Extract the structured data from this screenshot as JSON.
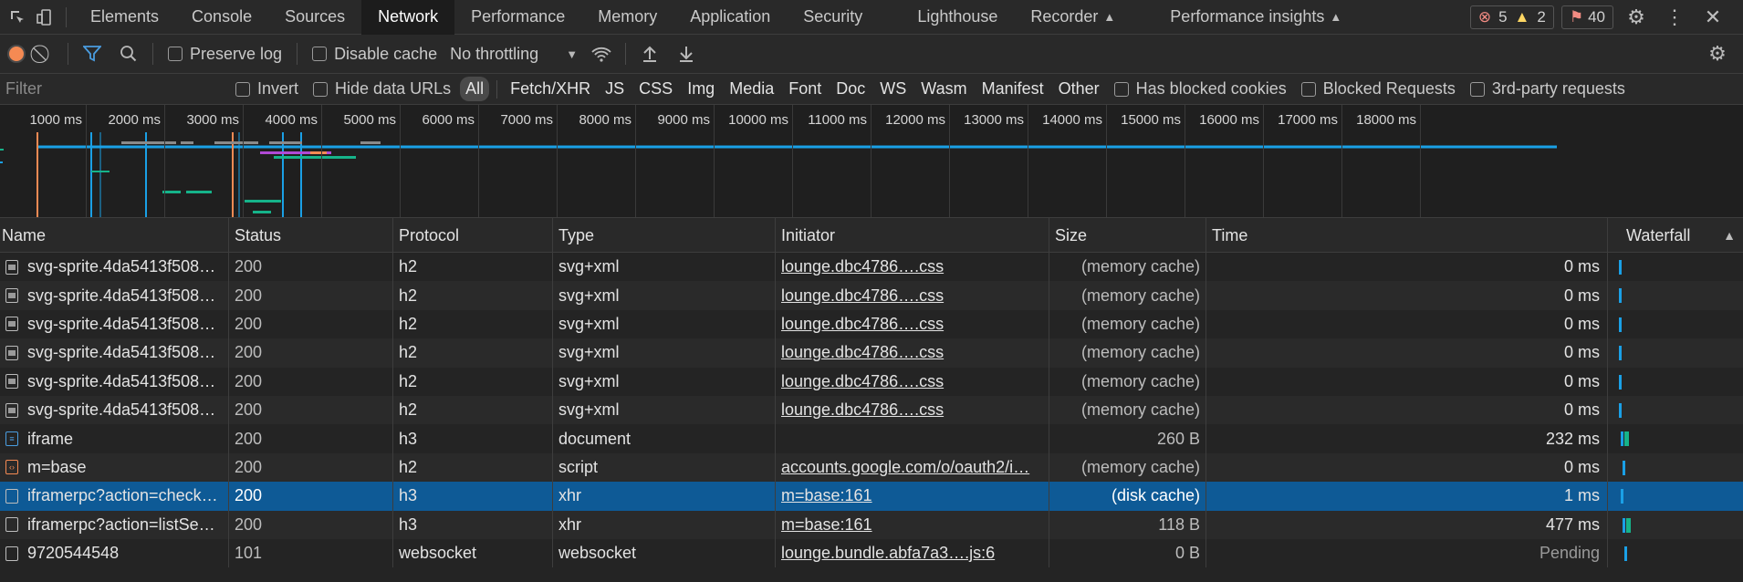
{
  "tabbar": {
    "tabs": [
      {
        "label": "Elements"
      },
      {
        "label": "Console"
      },
      {
        "label": "Sources"
      },
      {
        "label": "Network",
        "active": true
      },
      {
        "label": "Performance"
      },
      {
        "label": "Memory"
      },
      {
        "label": "Application"
      },
      {
        "label": "Security"
      },
      {
        "label": "Lighthouse"
      },
      {
        "label": "Recorder"
      },
      {
        "label": "Performance insights"
      }
    ],
    "errors": "5",
    "warnings": "2",
    "issues": "40"
  },
  "toolbar": {
    "preserve_log": "Preserve log",
    "disable_cache": "Disable cache",
    "throttling": "No throttling"
  },
  "filter": {
    "placeholder": "Filter",
    "invert": "Invert",
    "hide_data_urls": "Hide data URLs",
    "types": [
      "All",
      "Fetch/XHR",
      "JS",
      "CSS",
      "Img",
      "Media",
      "Font",
      "Doc",
      "WS",
      "Wasm",
      "Manifest",
      "Other"
    ],
    "has_blocked_cookies": "Has blocked cookies",
    "blocked_requests": "Blocked Requests",
    "third_party": "3rd-party requests"
  },
  "overview": {
    "ticks": [
      "1000 ms",
      "2000 ms",
      "3000 ms",
      "4000 ms",
      "5000 ms",
      "6000 ms",
      "7000 ms",
      "8000 ms",
      "9000 ms",
      "10000 ms",
      "11000 ms",
      "12000 ms",
      "13000 ms",
      "14000 ms",
      "15000 ms",
      "16000 ms",
      "17000 ms",
      "18000 ms"
    ]
  },
  "table": {
    "columns": {
      "name": "Name",
      "status": "Status",
      "protocol": "Protocol",
      "type": "Type",
      "initiator": "Initiator",
      "size": "Size",
      "time": "Time",
      "waterfall": "Waterfall"
    },
    "rows": [
      {
        "name": "svg-sprite.4da5413f508…",
        "status": "200",
        "protocol": "h2",
        "type": "svg+xml",
        "initiator": "lounge.dbc4786….css",
        "size": "(memory cache)",
        "time": "0 ms",
        "icon": "image-file-icon"
      },
      {
        "name": "svg-sprite.4da5413f508…",
        "status": "200",
        "protocol": "h2",
        "type": "svg+xml",
        "initiator": "lounge.dbc4786….css",
        "size": "(memory cache)",
        "time": "0 ms",
        "icon": "image-file-icon"
      },
      {
        "name": "svg-sprite.4da5413f508…",
        "status": "200",
        "protocol": "h2",
        "type": "svg+xml",
        "initiator": "lounge.dbc4786….css",
        "size": "(memory cache)",
        "time": "0 ms",
        "icon": "image-file-icon"
      },
      {
        "name": "svg-sprite.4da5413f508…",
        "status": "200",
        "protocol": "h2",
        "type": "svg+xml",
        "initiator": "lounge.dbc4786….css",
        "size": "(memory cache)",
        "time": "0 ms",
        "icon": "image-file-icon"
      },
      {
        "name": "svg-sprite.4da5413f508…",
        "status": "200",
        "protocol": "h2",
        "type": "svg+xml",
        "initiator": "lounge.dbc4786….css",
        "size": "(memory cache)",
        "time": "0 ms",
        "icon": "image-file-icon"
      },
      {
        "name": "svg-sprite.4da5413f508…",
        "status": "200",
        "protocol": "h2",
        "type": "svg+xml",
        "initiator": "lounge.dbc4786….css",
        "size": "(memory cache)",
        "time": "0 ms",
        "icon": "image-file-icon"
      },
      {
        "name": "iframe",
        "status": "200",
        "protocol": "h3",
        "type": "document",
        "initiator": "",
        "size": "260 B",
        "time": "232 ms",
        "icon": "document-file-icon"
      },
      {
        "name": "m=base",
        "status": "200",
        "protocol": "h2",
        "type": "script",
        "initiator": "accounts.google.com/o/oauth2/i…",
        "size": "(memory cache)",
        "time": "0 ms",
        "icon": "script-file-icon"
      },
      {
        "name": "iframerpc?action=check…",
        "status": "200",
        "protocol": "h3",
        "type": "xhr",
        "initiator": "m=base:161",
        "size": "(disk cache)",
        "time": "1 ms",
        "icon": "blank-file-icon",
        "selected": true
      },
      {
        "name": "iframerpc?action=listSe…",
        "status": "200",
        "protocol": "h3",
        "type": "xhr",
        "initiator": "m=base:161",
        "size": "118 B",
        "time": "477 ms",
        "icon": "blank-file-icon"
      },
      {
        "name": "9720544548",
        "status": "101",
        "protocol": "websocket",
        "type": "websocket",
        "initiator": "lounge.bundle.abfa7a3….js:6",
        "size": "0 B",
        "time": "Pending",
        "icon": "blank-file-icon"
      }
    ]
  },
  "colors": {
    "record": "#f58a53",
    "selected_row": "#0e5a96",
    "waterfall_blue": "#1aa0e6",
    "waterfall_green": "#16b38a"
  }
}
